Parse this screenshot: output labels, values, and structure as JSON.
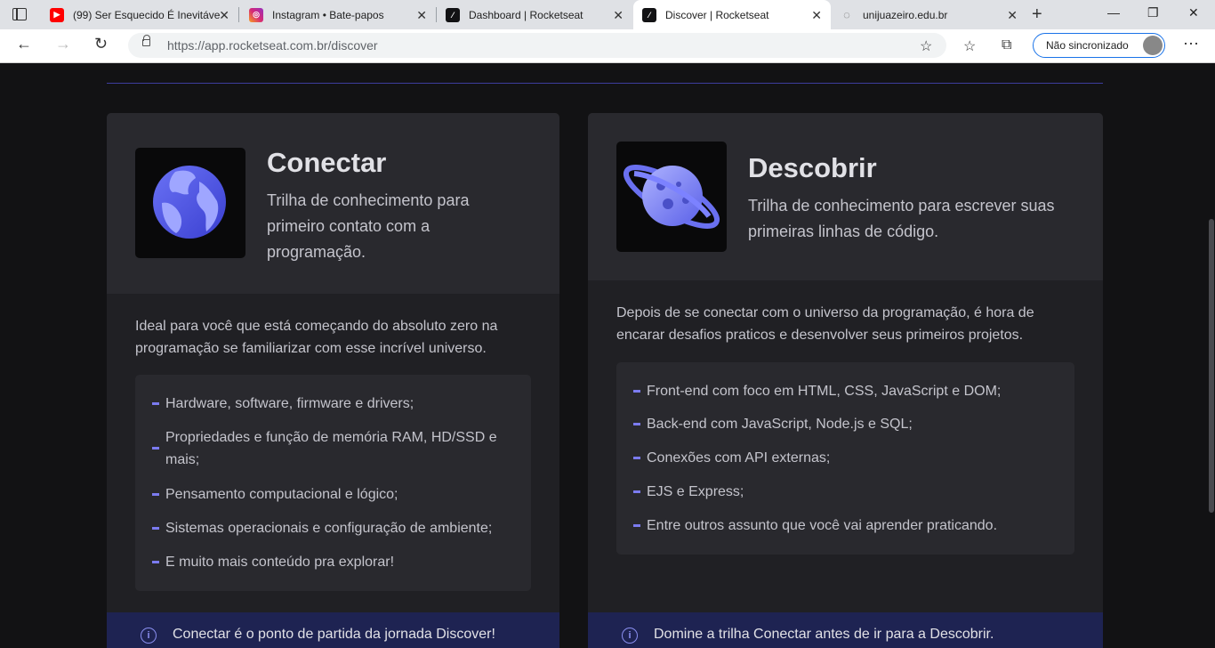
{
  "browser": {
    "tabs": [
      {
        "title": "(99) Ser Esquecido É Inevitáve",
        "favicon": "youtube-icon"
      },
      {
        "title": "Instagram • Bate-papos",
        "favicon": "instagram-icon"
      },
      {
        "title": "Dashboard | Rocketseat",
        "favicon": "rocketseat-icon"
      },
      {
        "title": "Discover | Rocketseat",
        "favicon": "rocketseat-icon"
      },
      {
        "title": "unijuazeiro.edu.br",
        "favicon": "loading-icon"
      }
    ],
    "url": "https://app.rocketseat.com.br/discover",
    "sync_label": "Não sincronizado"
  },
  "cards": [
    {
      "title": "Conectar",
      "subtitle": "Trilha de conhecimento para primeiro contato com a programação.",
      "description": "Ideal para você que está começando do absoluto zero na programação se familiarizar com esse incrível universo.",
      "items": [
        "Hardware, software, firmware e drivers;",
        "Propriedades e função de memória RAM, HD/SSD e mais;",
        "Pensamento computacional e lógico;",
        "Sistemas operacionais e configuração de ambiente;",
        "E muito mais conteúdo pra explorar!"
      ],
      "footer": "Conectar é o ponto de partida da jornada Discover!"
    },
    {
      "title": "Descobrir",
      "subtitle": "Trilha de conhecimento para escrever suas primeiras linhas de código.",
      "description": "Depois de se conectar com o universo da programação, é hora de encarar desafios praticos e desenvolver seus primeiros projetos.",
      "items": [
        "Front-end com foco em HTML, CSS, JavaScript e DOM;",
        "Back-end com JavaScript, Node.js e SQL;",
        "Conexões com API externas;",
        "EJS e Express;",
        "Entre outros assunto que você vai aprender praticando."
      ],
      "footer": "Domine a trilha Conectar antes de ir para a Descobrir."
    }
  ],
  "colors": {
    "accent": "#7b7bf0",
    "background": "#121214",
    "card": "#202024"
  }
}
